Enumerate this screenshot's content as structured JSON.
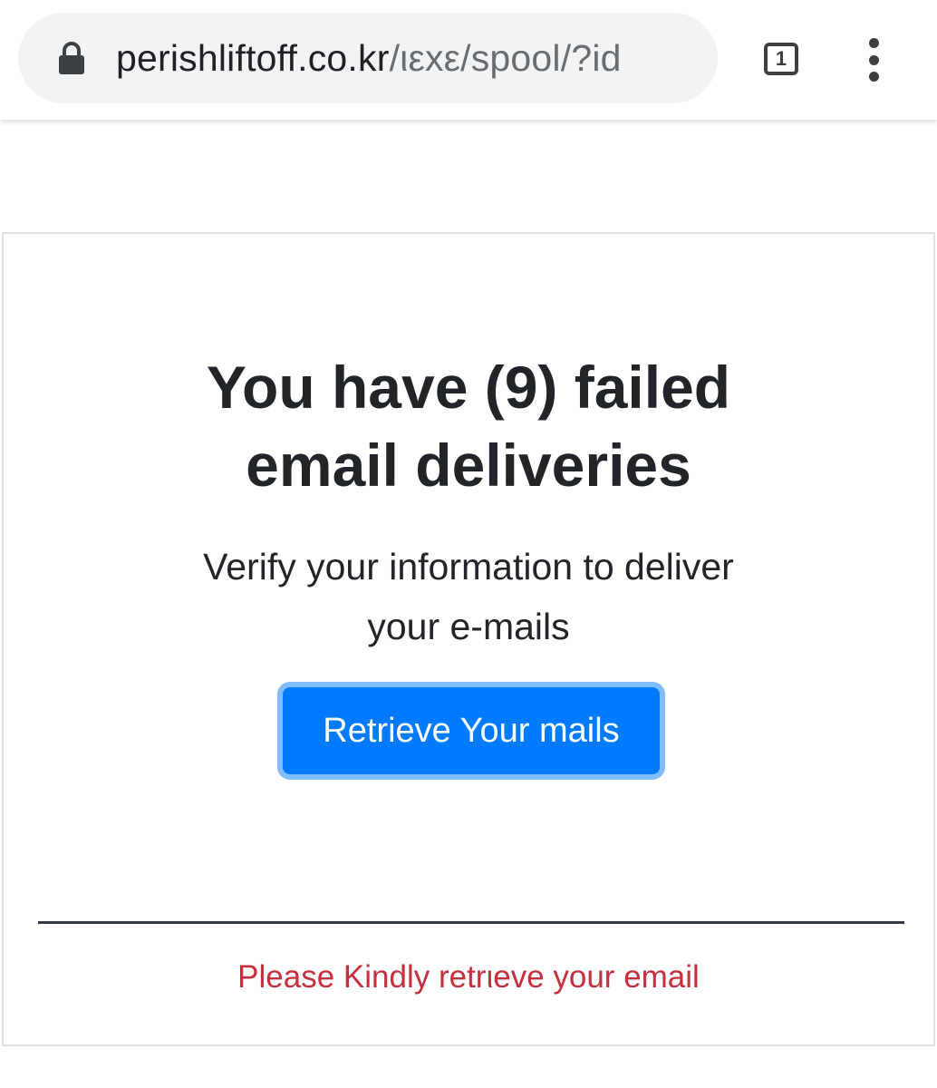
{
  "browser": {
    "url_host": "perishliftoff.co.kr",
    "url_path": "/ιεxε/spool/?id",
    "tab_count": "1",
    "icons": {
      "lock": "lock-icon",
      "tabs": "tab-switcher-icon",
      "menu": "more-vert-icon"
    }
  },
  "page": {
    "heading_line1": "You have (9) failed",
    "heading_line2": "email deliveries",
    "subtext_line1": "Verify your information to deliver",
    "subtext_line2": "your e-mails",
    "button_label": "Retrieve Your mails",
    "footer_note": "Please Kindly retrιeve your email"
  },
  "colors": {
    "button": "#007bff",
    "button_focus_ring": "#80bdff",
    "footer_note": "#c62f3d",
    "text": "#212529"
  }
}
